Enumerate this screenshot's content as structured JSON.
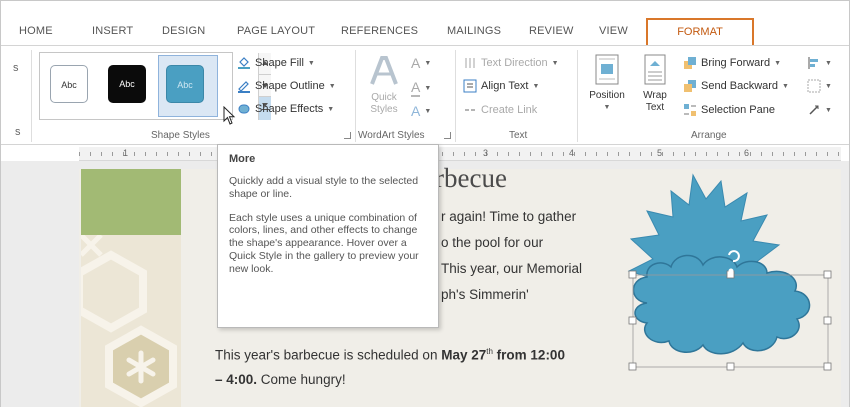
{
  "tabs": [
    "HOME",
    "INSERT",
    "DESIGN",
    "PAGE LAYOUT",
    "REFERENCES",
    "MAILINGS",
    "REVIEW",
    "VIEW"
  ],
  "active_tab": "FORMAT",
  "ribbon": {
    "shape_styles": {
      "swatches": [
        "Abc",
        "Abc",
        "Abc"
      ],
      "shape_fill": "Shape Fill",
      "shape_outline": "Shape Outline",
      "shape_effects": "Shape Effects",
      "label": "Shape Styles"
    },
    "wordart": {
      "quick_styles_line1": "Quick",
      "quick_styles_line2": "Styles",
      "label": "WordArt Styles"
    },
    "text_group": {
      "text_direction": "Text Direction",
      "align_text": "Align Text",
      "create_link": "Create Link",
      "label": "Text"
    },
    "arrange": {
      "position": "Position",
      "wrap_line1": "Wrap",
      "wrap_line2": "Text",
      "bring_forward": "Bring Forward",
      "send_backward": "Send Backward",
      "selection_pane": "Selection Pane",
      "label": "Arrange"
    },
    "left_stub": "s"
  },
  "ruler_numbers": [
    "1",
    "3",
    "4",
    "5",
    "6"
  ],
  "tooltip": {
    "title": "More",
    "para1": "Quickly add a visual style to the selected shape or line.",
    "para2": "Each style uses a unique combination of colors, lines, and other effects to change the shape's appearance. Hover over a Quick Style in the gallery to preview your new look."
  },
  "document": {
    "title_fragment": "rbecue",
    "lines": [
      "r again! Time to gather",
      "o the pool for our",
      "This year, our Memorial",
      "ph's Simmerin'"
    ],
    "schedule_prefix": "This year's barbecue is scheduled on ",
    "schedule_bold": "May 27",
    "schedule_sup": "th",
    "schedule_bold2": " from 12:00",
    "schedule_line2_bold": "– 4:00.",
    "schedule_line2_rest": " Come hungry!"
  },
  "colors": {
    "format_tab_border": "#d9772a",
    "shape_fill": "#4a9fc2",
    "green_block": "#a2ba74"
  }
}
